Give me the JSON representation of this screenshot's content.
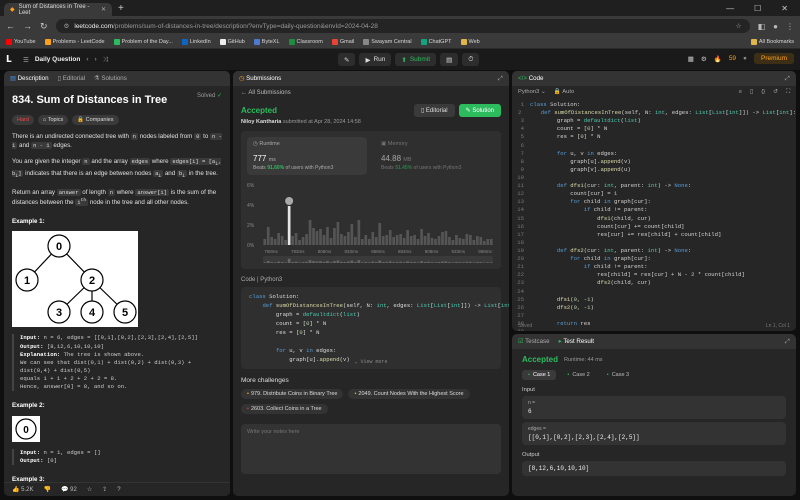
{
  "browser": {
    "tab_title": "Sum of Distances in Tree - Leet",
    "url_host": "leetcode.com",
    "url_path": "/problems/sum-of-distances-in-tree/description/?envType=daily-question&envId=2024-04-28"
  },
  "bookmarks": [
    "YouTube",
    "Problems - LeetCode",
    "Problem of the Day...",
    "LinkedIn",
    "GitHub",
    "ByteXL",
    "Classroom",
    "Gmail",
    "Swayam Central",
    "ChatGPT",
    "Web"
  ],
  "bookmarks_all": "All Bookmarks",
  "nav": {
    "daily": "Daily Question",
    "run": "Run",
    "submit": "Submit",
    "streak": "59",
    "premium": "Premium"
  },
  "desc": {
    "tabs": [
      "Description",
      "Editorial",
      "Solutions"
    ],
    "title": "834. Sum of Distances in Tree",
    "solved": "Solved",
    "tags": [
      "Hard",
      "Topics",
      "Companies"
    ],
    "p1a": "There is an undirected connected tree with ",
    "p1_n": "n",
    "p1b": " nodes labeled from ",
    "p1_0": "0",
    "p1c": " to ",
    "p1_n1": "n - 1",
    "p1d": " and ",
    "p1_n2": "n - 1",
    "p1e": " edges.",
    "p2a": "You are given the integer ",
    "p2_n": "n",
    "p2b": " and the array ",
    "p2_edges": "edges",
    "p2c": " where ",
    "p2_ei": "edges[i] = [a",
    "p2_ei2": ", b",
    "p2_ei3": "]",
    "p2d": " indicates that there is an edge between nodes ",
    "p2_a": "a",
    "p2e": " and ",
    "p2_b": "b",
    "p2f": " in the tree.",
    "p3a": "Return an array ",
    "p3_ans": "answer",
    "p3b": " of length ",
    "p3_n": "n",
    "p3c": " where ",
    "p3_ansi": "answer[i]",
    "p3d": " is the sum of the distances between the ",
    "p3_ith": "i",
    "p3e": " node in the tree and all other nodes.",
    "ex1": "Example 1:",
    "ex1_lines": [
      [
        "Input:",
        " n = 6, edges = [[0,1],[0,2],[2,3],[2,4],[2,5]]"
      ],
      [
        "Output:",
        " [8,12,6,10,10,10]"
      ],
      [
        "Explanation:",
        " The tree is shown above."
      ],
      [
        "",
        "We can see that dist(0,1) + dist(0,2) + dist(0,3) +"
      ],
      [
        "",
        "dist(0,4) + dist(0,5)"
      ],
      [
        "",
        "equals 1 + 1 + 2 + 2 + 2 = 8."
      ],
      [
        "",
        "Hence, answer[0] = 8, and so on."
      ]
    ],
    "ex2": "Example 2:",
    "ex2_lines": [
      [
        "Input:",
        " n = 1, edges = []"
      ],
      [
        "Output:",
        " [0]"
      ]
    ],
    "ex3": "Example 3:",
    "tree_nodes": [
      "0",
      "1",
      "2",
      "3",
      "4",
      "5"
    ],
    "tree2_node": "0",
    "likes": "5.2K",
    "comments": "92"
  },
  "subs": {
    "tab": "Submissions",
    "back": "All Submissions",
    "status": "Accepted",
    "editorial": "Editorial",
    "solution": "Solution",
    "user": "Niloy Kantharia",
    "submitted": "submitted at Apr 28, 2024 14:58",
    "runtime_label": "Runtime",
    "runtime_val": "777",
    "runtime_unit": "ms",
    "runtime_beats_label": "Beats",
    "runtime_beats": "91.60%",
    "runtime_beats_tail": "of users with Python3",
    "memory_label": "Memory",
    "memory_val": "44.88",
    "memory_unit": "MB",
    "memory_beats_label": "Beats",
    "memory_beats": "51.45%",
    "memory_beats_tail": "of users with Python3",
    "code_hdr": "Code | Python3",
    "view_more": "View more",
    "more": "More challenges",
    "challenges": [
      [
        "979.",
        "Distribute Coins in Binary Tree",
        "med"
      ],
      [
        "2049.",
        "Count Nodes With the Highest Score",
        "med"
      ],
      [
        "2603.",
        "Collect Coins in a Tree",
        "hard"
      ]
    ],
    "notes": "Write your notes here"
  },
  "chart_data": {
    "type": "bar",
    "xlabel": "",
    "ylabel": "",
    "ylim": [
      0,
      6
    ],
    "yticks": [
      "6%",
      "4%",
      "2%",
      "0%"
    ],
    "xticks": [
      "758ms",
      "783ms",
      "808ms",
      "833ms",
      "858ms",
      "883ms",
      "908ms",
      "933ms",
      "958ms"
    ],
    "highlight": "777ms",
    "values": [
      0.6,
      1.8,
      0.8,
      0.6,
      1.2,
      0.9,
      0.5,
      3.9,
      0.9,
      1.2,
      0.5,
      0.8,
      1.1,
      2.5,
      1.7,
      1.4,
      1.6,
      1.0,
      1.8,
      0.7,
      1.7,
      2.3,
      1.1,
      0.9,
      1.3,
      2.1,
      0.8,
      2.5,
      0.6,
      1.0,
      0.6,
      1.3,
      0.8,
      2.2,
      0.9,
      1.0,
      1.5,
      0.8,
      1.0,
      1.1,
      0.7,
      1.5,
      0.9,
      1.0,
      0.6,
      1.6,
      0.9,
      1.2,
      0.7,
      0.6,
      0.9,
      1.3,
      1.4,
      0.8,
      0.5,
      1.0,
      0.7,
      0.6,
      1.1,
      1.0,
      0.5,
      0.9,
      0.8,
      0.4,
      0.6,
      0.6
    ]
  },
  "code": {
    "tab": "Code",
    "lang": "Python3",
    "auto": "Auto",
    "saved": "Saved",
    "pos": "Ln 1, Col 1",
    "lines": [
      "class Solution:",
      "    def sumOfDistancesInTree(self, N: int, edges: List[List[int]]) -> List[int]:",
      "        graph = defaultdict(list)",
      "        count = [0] * N",
      "        res = [0] * N",
      "",
      "        for u, v in edges:",
      "            graph[u].append(v)",
      "            graph[v].append(u)",
      "",
      "        def dfs1(cur: int, parent: int) -> None:",
      "            count[cur] = 1",
      "            for child in graph[cur]:",
      "                if child != parent:",
      "                    dfs1(child, cur)",
      "                    count[cur] += count[child]",
      "                    res[cur] += res[child] + count[child]",
      "",
      "        def dfs2(cur: int, parent: int) -> None:",
      "            for child in graph[cur]:",
      "                if child != parent:",
      "                    res[child] = res[cur] + N - 2 * count[child]",
      "                    dfs2(child, cur)",
      "",
      "        dfs1(0, -1)",
      "        dfs2(0, -1)",
      "",
      "        return res",
      "",
      ""
    ],
    "snippet": [
      "class Solution:",
      "    def sumOfDistancesInTree(self, N: int, edges: List[List[int]]) -> List[int]:",
      "        graph = defaultdict(list)",
      "        count = [0] * N",
      "        res = [0] * N",
      "",
      "        for u, v in edges:",
      "            graph[u].append(v)"
    ]
  },
  "test": {
    "tabs": [
      "Testcase",
      "Test Result"
    ],
    "status": "Accepted",
    "runtime": "Runtime: 44 ms",
    "cases": [
      "Case 1",
      "Case 2",
      "Case 3"
    ],
    "input_label": "Input",
    "n_key": "n =",
    "n_val": "6",
    "edges_key": "edges =",
    "edges_val": "[[0,1],[0,2],[2,3],[2,4],[2,5]]",
    "output_label": "Output",
    "output_val": "[8,12,6,10,10,10]"
  }
}
